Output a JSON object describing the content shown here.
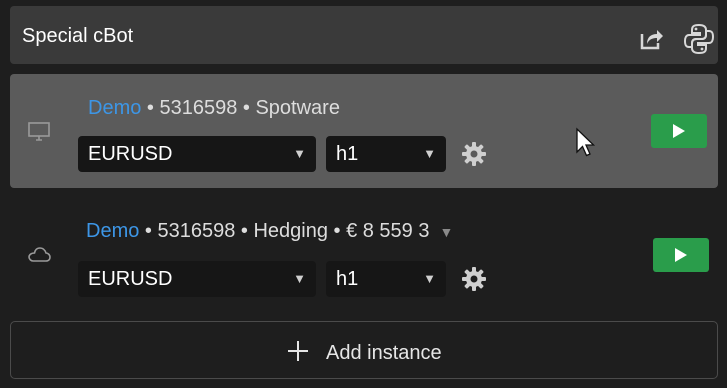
{
  "header": {
    "title": "Special cBot",
    "icons": [
      "share-icon",
      "python-icon"
    ]
  },
  "instances": [
    {
      "state": "hover",
      "icon": "monitor-icon",
      "account_type": "Demo",
      "info_rest": " • 5316598 •  Spotware",
      "symbol": "EURUSD",
      "timeframe": "h1"
    },
    {
      "state": "normal",
      "icon": "cloud-icon",
      "account_type": "Demo",
      "info_rest": " • 5316598 • Hedging • € 8 559 3",
      "has_dropdown": true,
      "symbol": "EURUSD",
      "timeframe": "h1"
    }
  ],
  "add_instance": {
    "label": "Add instance"
  },
  "colors": {
    "play": "#2a9d4b",
    "account_type": "#3d96e6"
  }
}
